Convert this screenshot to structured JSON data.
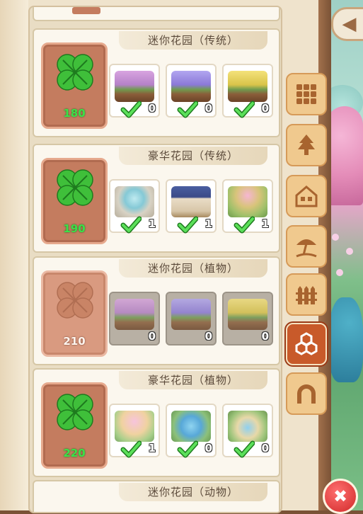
{
  "header": {
    "back_icon": "back-arrow-icon"
  },
  "cards": [
    {
      "title": "迷你花园（传统）",
      "cost": "180",
      "locked": false,
      "items": [
        {
          "pic": "bed",
          "count": "0",
          "owned": true
        },
        {
          "pic": "bed purple",
          "count": "0",
          "owned": true
        },
        {
          "pic": "bed yellow",
          "count": "0",
          "owned": true
        }
      ]
    },
    {
      "title": "豪华花园（传统）",
      "cost": "190",
      "locked": false,
      "items": [
        {
          "pic": "fountain",
          "count": "1",
          "owned": true
        },
        {
          "pic": "gazebo",
          "count": "1",
          "owned": true
        },
        {
          "pic": "tower",
          "count": "1",
          "owned": true
        }
      ]
    },
    {
      "title": "迷你花园（植物）",
      "cost": "210",
      "locked": true,
      "items": [
        {
          "pic": "bed",
          "count": "0",
          "owned": false
        },
        {
          "pic": "bed purple",
          "count": "0",
          "owned": false
        },
        {
          "pic": "bed yellow",
          "count": "0",
          "owned": false
        }
      ]
    },
    {
      "title": "豪华花园（植物）",
      "cost": "220",
      "locked": false,
      "items": [
        {
          "pic": "umbrella",
          "count": "1",
          "owned": true
        },
        {
          "pic": "pond",
          "count": "0",
          "owned": true
        },
        {
          "pic": "arch",
          "count": "0",
          "owned": true
        }
      ]
    }
  ],
  "last_card_title": "迷你花园（动物）",
  "tabs": [
    {
      "name": "tab-grid",
      "icon": "grid-icon",
      "active": false
    },
    {
      "name": "tab-tree",
      "icon": "tree-icon",
      "active": false
    },
    {
      "name": "tab-house",
      "icon": "house-icon",
      "active": false
    },
    {
      "name": "tab-beach",
      "icon": "beach-umbrella-icon",
      "active": false
    },
    {
      "name": "tab-fence",
      "icon": "fence-icon",
      "active": false
    },
    {
      "name": "tab-hexagon",
      "icon": "hexagon-icon",
      "active": true
    },
    {
      "name": "tab-arch",
      "icon": "arch-icon",
      "active": false
    }
  ],
  "colors": {
    "clover_green": "#3fbf3a",
    "clover_locked": "#c98466",
    "active_tab": "#c85a2a",
    "tab": "#f0c98e",
    "cost_owned": "#3ce048"
  }
}
